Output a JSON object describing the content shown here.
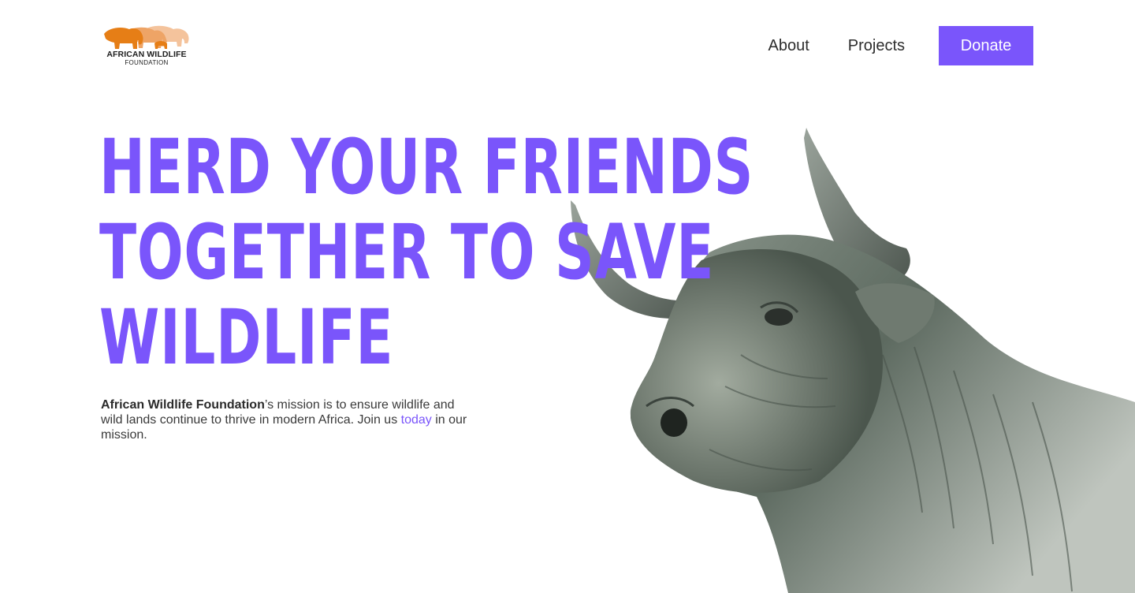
{
  "header": {
    "logo": {
      "line1": "AFRICAN WILDLIFE",
      "line2": "FOUNDATION",
      "icon": "elephant-herd-logo-icon",
      "colors": [
        "#e67e16",
        "#f2b98a"
      ]
    },
    "nav": {
      "about": "About",
      "projects": "Projects",
      "donate": "Donate"
    }
  },
  "hero": {
    "headline": [
      "HERD YOUR FRIENDS",
      "TOGETHER TO SAVE",
      "WILDLIFE"
    ],
    "mission": {
      "org_name": "African Wildlife Foundation",
      "text_1": "’s mission is to ensure wildlife and wild lands continue to thrive in modern Africa. Join us ",
      "link": "today",
      "text_2": " in our mission."
    },
    "image": "bull-photo"
  },
  "colors": {
    "accent": "#7a55fb",
    "text": "#2d2d2d",
    "logo_orange": "#e67e16",
    "background": "#ffffff"
  }
}
